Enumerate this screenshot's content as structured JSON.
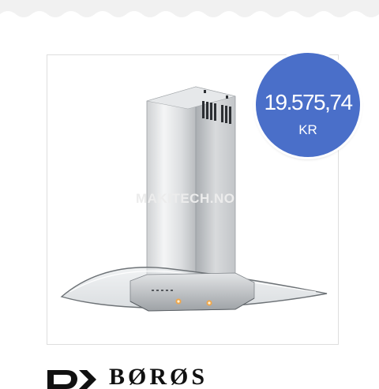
{
  "product": {
    "watermark_text": "MAKITECH.NO",
    "image_icon": "range-hood-image"
  },
  "price": {
    "amount": "19.575,74",
    "currency": "KR",
    "badge_color": "#4a6fc9"
  },
  "brand": {
    "name": "BØRØS"
  }
}
